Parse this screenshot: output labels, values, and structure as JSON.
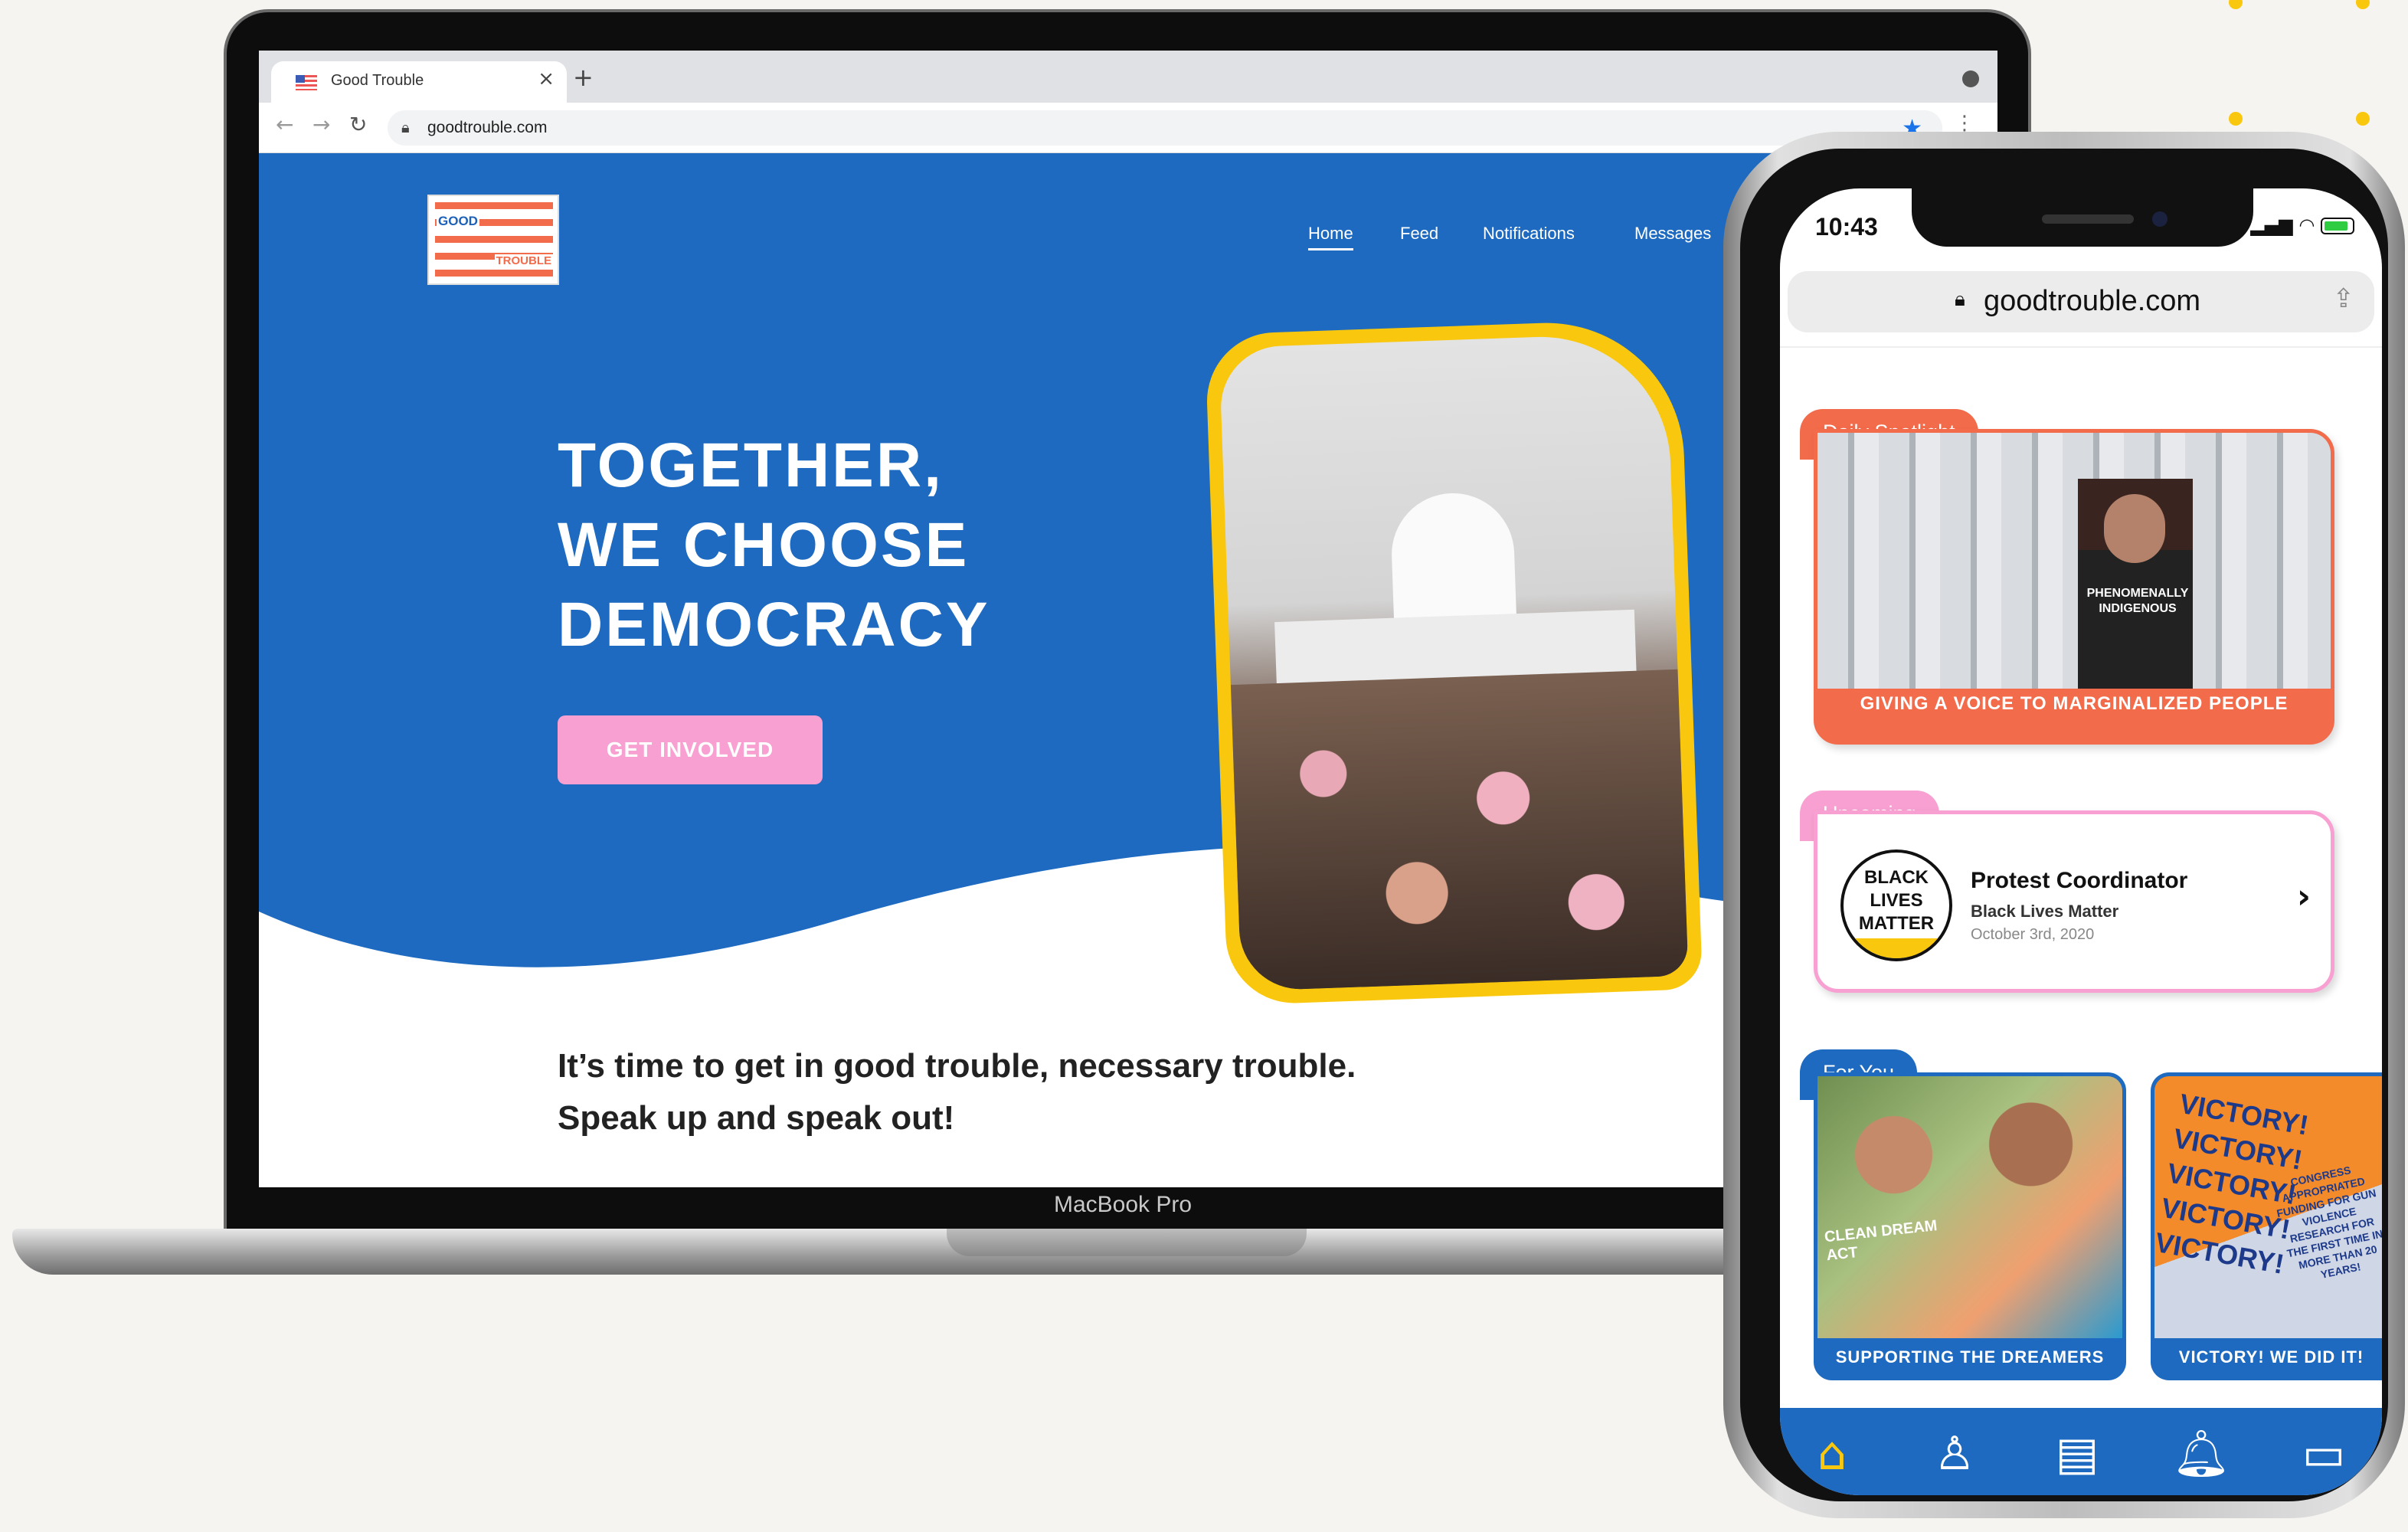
{
  "laptop": {
    "browser": {
      "tab_title": "Good Trouble",
      "tab_close": "×",
      "new_tab": "+",
      "url": "goodtrouble.com",
      "back_icon": "←",
      "forward_icon": "→",
      "reload_icon": "↻",
      "star_icon": "★",
      "menu_icon": "⋮"
    },
    "site": {
      "logo_top": "GOOD",
      "logo_bottom": "TROUBLE",
      "nav": [
        "Home",
        "Feed",
        "Notifications",
        "Messages"
      ],
      "hero_title_lines": [
        "Together,",
        "we choose",
        "democracy"
      ],
      "cta_label": "GET INVOLVED",
      "tagline_lines": [
        "It’s time to get in good trouble, necessary trouble.",
        "Speak up and speak out!"
      ]
    },
    "label": "MacBook Pro"
  },
  "phone": {
    "status": {
      "time": "10:43"
    },
    "url": "goodtrouble.com",
    "spotlight": {
      "tab": "Daily Spotlight",
      "shirt_text": "PHENOMENALLY INDIGENOUS",
      "caption": "Giving a voice to marginalized people"
    },
    "upcoming": {
      "tab": "Upcoming",
      "logo_lines": [
        "BLACK",
        "LIVES",
        "MATTER"
      ],
      "title": "Protest Coordinator",
      "org": "Black Lives Matter",
      "date": "October 3rd, 2020",
      "arrow": "›"
    },
    "for_you": {
      "tab": "For You",
      "cards": [
        {
          "caption": "Supporting the Dreamers",
          "sign_text": "CLEAN DREAM ACT"
        },
        {
          "caption": "Victory! We did it!",
          "sign_text": "VICTORY! VICTORY! VICTORY! VICTORY! VICTORY!",
          "side_text": "CONGRESS APPROPRIATED FUNDING FOR GUN VIOLENCE RESEARCH FOR THE FIRST TIME IN MORE THAN 20 YEARS!"
        }
      ]
    },
    "tabbar_icons": [
      "home-icon",
      "profile-icon",
      "clipboard-icon",
      "bell-icon",
      "chat-icon"
    ]
  },
  "colors": {
    "brand_blue": "#1d6ac0",
    "accent_yellow": "#f9c80e",
    "accent_pink": "#f7a0d1",
    "accent_orange": "#f26b4b",
    "background": "#f6f4f0"
  }
}
